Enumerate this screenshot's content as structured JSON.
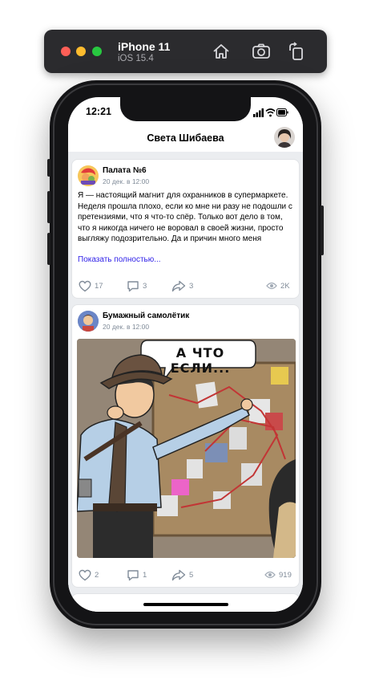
{
  "simulator": {
    "device": "iPhone 11",
    "os": "iOS 15.4",
    "icons": [
      "home-icon",
      "screenshot-icon",
      "rotate-icon"
    ]
  },
  "status_bar": {
    "time": "12:21"
  },
  "nav": {
    "title": "Света Шибаева"
  },
  "posts": [
    {
      "author": "Палата №6",
      "date": "20 дек. в 12:00",
      "text": "Я — настоящий магнит для охранников в супермаркете. Неделя прошла плохо, если ко мне ни разу не подошли с претензиями, что я что-то спёр. Только вот дело в том, что я никогда ничего не воровал в своей жизни, просто выгляжу подозрительно. Да и причин много меня",
      "more": "Показать полностью...",
      "likes": "17",
      "comments": "3",
      "shares": "3",
      "views": "2K"
    },
    {
      "author": "Бумажный самолётик",
      "date": "20 дек. в 12:00",
      "image_caption": "А ЧТО ЕСЛИ...",
      "likes": "2",
      "comments": "1",
      "shares": "5",
      "views": "919"
    }
  ],
  "colors": {
    "link": "#2d1ee8",
    "secondary": "#818c99",
    "feed_bg": "#ebedf0"
  }
}
